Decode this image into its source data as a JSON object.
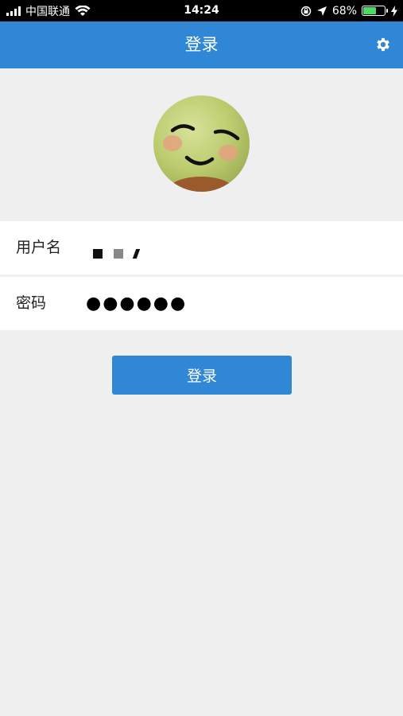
{
  "status_bar": {
    "carrier": "中国联通",
    "time": "14:24",
    "battery": "68%",
    "battery_level": 0.68
  },
  "nav": {
    "title": "登录",
    "settings_icon": "gear-icon"
  },
  "avatar": {
    "icon": "smiling-face-avatar"
  },
  "form": {
    "username_label": "用户名",
    "password_label": "密码",
    "password_value": "●●●●●●"
  },
  "actions": {
    "login_label": "登录"
  },
  "colors": {
    "primary": "#3087d5",
    "background": "#efeff0",
    "row_background": "#ffffff"
  }
}
